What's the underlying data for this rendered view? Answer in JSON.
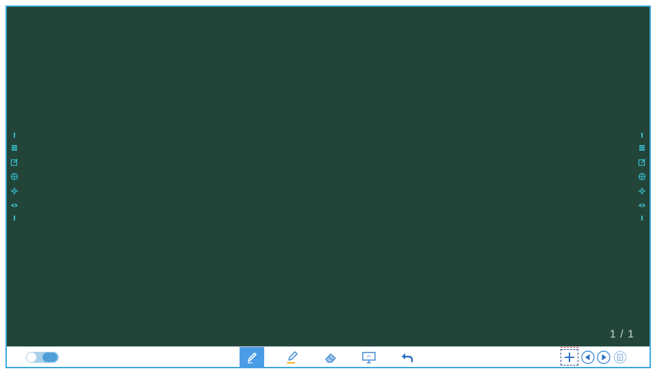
{
  "board": {
    "background_color": "#234539",
    "page_indicator": "1 / 1"
  },
  "side_menus": {
    "icons": [
      "menu-icon",
      "edit-icon",
      "globe-icon",
      "settings-icon",
      "eye-icon"
    ],
    "color": "#38bfd3"
  },
  "toolbar": {
    "toggle_state": "on",
    "tools": [
      {
        "name": "pen-tool",
        "icon": "pen-icon",
        "active": true
      },
      {
        "name": "highlighter-tool",
        "icon": "highlighter-icon",
        "active": false
      },
      {
        "name": "eraser-tool",
        "icon": "eraser-icon",
        "active": false
      },
      {
        "name": "screen-tool",
        "icon": "monitor-icon",
        "active": false
      },
      {
        "name": "undo-tool",
        "icon": "undo-icon",
        "active": false
      }
    ],
    "page_controls": [
      "add-page-icon",
      "previous-page-icon",
      "next-page-icon",
      "page-list-icon"
    ],
    "accent_color": "#4a9ce6"
  }
}
